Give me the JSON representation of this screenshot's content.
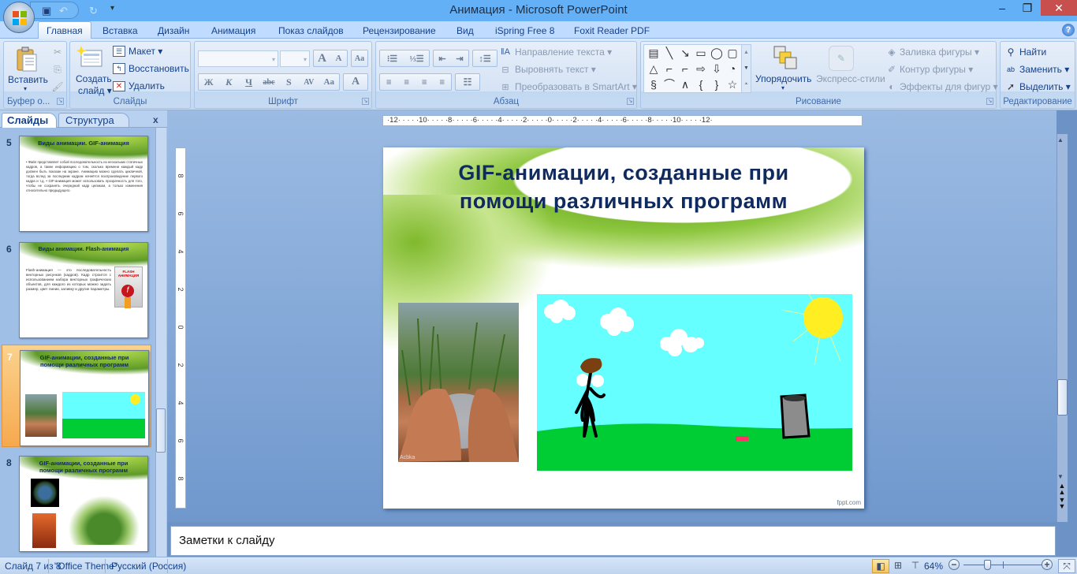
{
  "window": {
    "title": "Анимация - Microsoft PowerPoint",
    "minimize_icon": "minimize-icon",
    "restore_icon": "restore-icon",
    "close_icon": "close-icon"
  },
  "quick_access": {
    "save_icon": "save-icon",
    "undo_icon": "undo-icon",
    "redo_icon": "redo-icon",
    "customize_icon": "customize-qat-icon"
  },
  "tabs": [
    {
      "label": "Главная",
      "active": true
    },
    {
      "label": "Вставка"
    },
    {
      "label": "Дизайн"
    },
    {
      "label": "Анимация"
    },
    {
      "label": "Показ слайдов"
    },
    {
      "label": "Рецензирование"
    },
    {
      "label": "Вид"
    },
    {
      "label": "iSpring Free 8"
    },
    {
      "label": "Foxit Reader PDF"
    }
  ],
  "help_label": "?",
  "ribbon": {
    "clipboard": {
      "paste_label": "Вставить",
      "group_label": "Буфер о..."
    },
    "slides": {
      "new_slide_line1": "Создать",
      "new_slide_line2": "слайд ▾",
      "layout_label": "Макет ▾",
      "reset_label": "Восстановить",
      "delete_label": "Удалить",
      "group_label": "Слайды"
    },
    "font": {
      "font_name_value": "",
      "font_size_value": "",
      "grow_label": "A",
      "shrink_label": "A",
      "bold_label": "Ж",
      "italic_label": "К",
      "underline_label": "Ч",
      "strike_label": "abc",
      "shadow_label": "S",
      "spacing_label": "AV",
      "case_label": "Aa",
      "color_label": "A",
      "group_label": "Шрифт"
    },
    "paragraph": {
      "text_direction_label": "Направление текста ▾",
      "align_text_label": "Выровнять текст ▾",
      "smartart_label": "Преобразовать в SmartArt ▾",
      "group_label": "Абзац"
    },
    "drawing": {
      "arrange_label": "Упорядочить",
      "quick_styles_label": "Экспресс-стили",
      "shape_fill_label": "Заливка фигуры ▾",
      "shape_outline_label": "Контур фигуры ▾",
      "shape_effects_label": "Эффекты для фигур ▾",
      "group_label": "Рисование",
      "shapes": [
        "▤",
        "╲",
        "↘",
        "▭",
        "◯",
        "▢",
        "△",
        "⌐",
        "⌐",
        "⇨",
        "⇩",
        "◔",
        "§",
        "⌒",
        "∧",
        "{",
        "}",
        "☆"
      ]
    },
    "editing": {
      "find_label": "Найти",
      "replace_label": "Заменить ▾",
      "select_label": "Выделить ▾",
      "group_label": "Редактирование"
    }
  },
  "left_pane": {
    "tab_slides": "Слайды",
    "tab_outline": "Структура",
    "close_label": "x",
    "thumbnails": [
      {
        "number": "5",
        "title": "Виды анимации. GIF-анимация",
        "text": "• Файл представляет собой последовательность из нескольких статичных кадров, а также информацию о том, сколько времени каждый кадр должен быть показан на экране. Анимацию можно сделать цикличной, тогда вслед за последним кадром начнётся воспроизведение первого кадра и т.д. • GIF-анимация может использовать прозрачность для того, чтобы не сохранять очередной кадр целиком, а только изменения относительно предыдущего."
      },
      {
        "number": "6",
        "title": "Виды анимации. Flash-анимация",
        "text": "Flash-анимация — это последовательность векторных рисунков (кадров). Кадр строится с использованием набора векторных графических объектов, для каждого из которых можно задать размер, цвет линии, заливку и другие параметры.",
        "image_label": "FLASH АНИМАЦИЯ"
      },
      {
        "number": "7",
        "title": "GIF-анимации, созданные при помощи различных программ",
        "selected": true
      },
      {
        "number": "8",
        "title": "GIF-анимации, созданные при помощи различных программ"
      }
    ]
  },
  "ruler": {
    "horizontal": "·12· · · · ·10· · · · ·8· · · · ·6· · · · ·4· · · · ·2· · · · ·0· · · · ·2· · · · ·4· · · · ·6· · · · ·8· · · · ·10· · · · ·12·",
    "vertical_labels": [
      "8",
      "6",
      "4",
      "2",
      "0",
      "2",
      "4",
      "6",
      "8"
    ]
  },
  "slide": {
    "title_line1": "GIF-анимации, созданные при",
    "title_line2": "помощи различных программ",
    "photo_caption": "Acbka",
    "watermark": "fppt.com"
  },
  "notes": {
    "placeholder": "Заметки к слайду"
  },
  "status_bar": {
    "slide_info": "Слайд 7 из 8",
    "theme": "\"Office Theme\"",
    "language": "Русский (Россия)",
    "zoom_percent": "64%",
    "zoom_value": 64
  }
}
